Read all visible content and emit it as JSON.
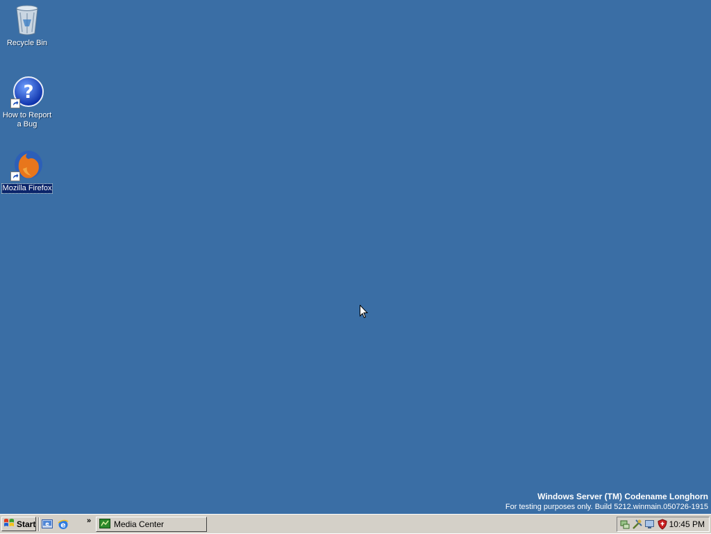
{
  "desktop": {
    "background_color": "#3a6ea5",
    "icons": [
      {
        "label": "Recycle Bin",
        "icon": "recycle-bin-icon"
      },
      {
        "label": "How to Report a Bug",
        "label_lines": [
          "How to Report",
          "a Bug"
        ],
        "icon": "help-icon"
      },
      {
        "label": "Mozilla Firefox",
        "icon": "firefox-icon",
        "selected": true
      }
    ]
  },
  "watermark": {
    "title": "Windows Server (TM) Codename Longhorn",
    "subtitle": "For testing purposes only. Build 5212.winmain.050726-1915"
  },
  "taskbar": {
    "start_label": "Start",
    "quick_launch": [
      "show-desktop-icon",
      "internet-explorer-icon"
    ],
    "chevron": "»",
    "tasks": [
      {
        "label": "Media Center",
        "icon": "media-center-icon"
      }
    ],
    "tray_icons": [
      "network-icon",
      "tools-icon",
      "display-icon",
      "security-shield-icon"
    ],
    "clock": "10:45 PM"
  }
}
